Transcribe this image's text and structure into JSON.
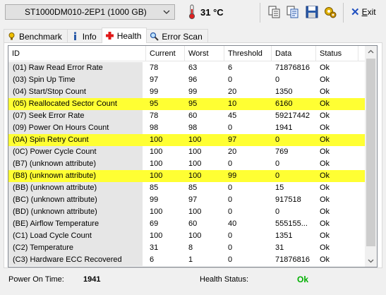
{
  "toolbar": {
    "drive": "ST1000DM010-2EP1 (1000 GB)",
    "temperature": "31 °C",
    "exit_label": "Exit",
    "exit_underline": "E"
  },
  "tabs": [
    {
      "label": "Benchmark",
      "icon": "benchmark-icon"
    },
    {
      "label": "Info",
      "icon": "info-icon"
    },
    {
      "label": "Health",
      "icon": "health-cross-icon",
      "active": true
    },
    {
      "label": "Error Scan",
      "icon": "magnifier-icon"
    }
  ],
  "table": {
    "headers": [
      "ID",
      "Current",
      "Worst",
      "Threshold",
      "Data",
      "Status"
    ],
    "rows": [
      {
        "id": "(01) Raw Read Error Rate",
        "current": "78",
        "worst": "63",
        "threshold": "6",
        "data": "71876816",
        "status": "Ok",
        "hl": false
      },
      {
        "id": "(03) Spin Up Time",
        "current": "97",
        "worst": "96",
        "threshold": "0",
        "data": "0",
        "status": "Ok",
        "hl": false
      },
      {
        "id": "(04) Start/Stop Count",
        "current": "99",
        "worst": "99",
        "threshold": "20",
        "data": "1350",
        "status": "Ok",
        "hl": false
      },
      {
        "id": "(05) Reallocated Sector Count",
        "current": "95",
        "worst": "95",
        "threshold": "10",
        "data": "6160",
        "status": "Ok",
        "hl": true
      },
      {
        "id": "(07) Seek Error Rate",
        "current": "78",
        "worst": "60",
        "threshold": "45",
        "data": "59217442",
        "status": "Ok",
        "hl": false
      },
      {
        "id": "(09) Power On Hours Count",
        "current": "98",
        "worst": "98",
        "threshold": "0",
        "data": "1941",
        "status": "Ok",
        "hl": false
      },
      {
        "id": "(0A) Spin Retry Count",
        "current": "100",
        "worst": "100",
        "threshold": "97",
        "data": "0",
        "status": "Ok",
        "hl": true
      },
      {
        "id": "(0C) Power Cycle Count",
        "current": "100",
        "worst": "100",
        "threshold": "20",
        "data": "769",
        "status": "Ok",
        "hl": false
      },
      {
        "id": "(B7) (unknown attribute)",
        "current": "100",
        "worst": "100",
        "threshold": "0",
        "data": "0",
        "status": "Ok",
        "hl": false
      },
      {
        "id": "(B8) (unknown attribute)",
        "current": "100",
        "worst": "100",
        "threshold": "99",
        "data": "0",
        "status": "Ok",
        "hl": true
      },
      {
        "id": "(BB) (unknown attribute)",
        "current": "85",
        "worst": "85",
        "threshold": "0",
        "data": "15",
        "status": "Ok",
        "hl": false
      },
      {
        "id": "(BC) (unknown attribute)",
        "current": "99",
        "worst": "97",
        "threshold": "0",
        "data": "917518",
        "status": "Ok",
        "hl": false
      },
      {
        "id": "(BD) (unknown attribute)",
        "current": "100",
        "worst": "100",
        "threshold": "0",
        "data": "0",
        "status": "Ok",
        "hl": false
      },
      {
        "id": "(BE) Airflow Temperature",
        "current": "69",
        "worst": "60",
        "threshold": "40",
        "data": "555155...",
        "status": "Ok",
        "hl": false
      },
      {
        "id": "(C1) Load Cycle Count",
        "current": "100",
        "worst": "100",
        "threshold": "0",
        "data": "1351",
        "status": "Ok",
        "hl": false
      },
      {
        "id": "(C2) Temperature",
        "current": "31",
        "worst": "8",
        "threshold": "0",
        "data": "31",
        "status": "Ok",
        "hl": false
      },
      {
        "id": "(C3) Hardware ECC Recovered",
        "current": "6",
        "worst": "1",
        "threshold": "0",
        "data": "71876816",
        "status": "Ok",
        "hl": false
      }
    ]
  },
  "footer": {
    "power_on_label": "Power On Time:",
    "power_on_value": "1941",
    "health_label": "Health Status:",
    "health_value": "Ok"
  },
  "colors": {
    "highlight": "#ffff33",
    "ok_green": "#00b000",
    "id_column_bg": "#e6e6e6"
  }
}
